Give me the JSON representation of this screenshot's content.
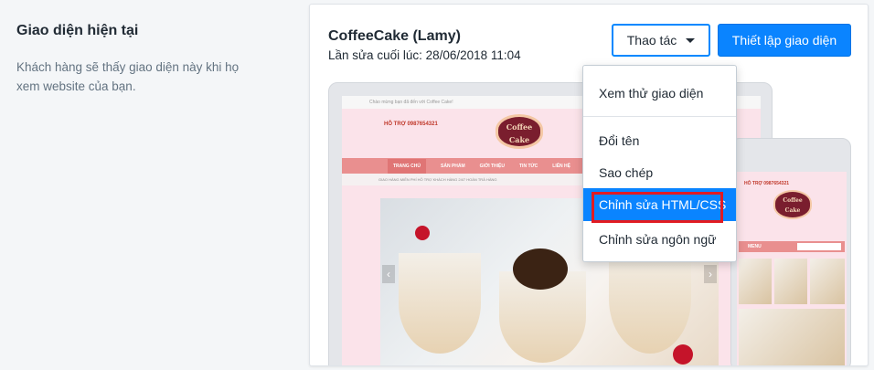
{
  "section": {
    "title": "Giao diện hiện tại",
    "description": "Khách hàng sẽ thấy giao diện này khi họ xem website của bạn."
  },
  "theme": {
    "name": "CoffeeCake (Lamy)",
    "last_edited": "Lần sửa cuối lúc: 28/06/2018 11:04"
  },
  "buttons": {
    "actions_label": "Thao tác",
    "customize_label": "Thiết lập giao diện"
  },
  "dropdown": {
    "items": [
      {
        "label": "Xem thử giao diện"
      },
      {
        "label": "Đổi tên"
      },
      {
        "label": "Sao chép"
      },
      {
        "label": "Chỉnh sửa HTML/CSS",
        "active": true,
        "highlighted": true
      },
      {
        "label": "Chỉnh sửa ngôn ngữ"
      }
    ]
  },
  "preview": {
    "topbar_text": "Chào mừng bạn đã đến với Coffee Cake!",
    "hotline": "HỖ TRỢ 0987654321",
    "logo_line1": "Coffee",
    "logo_line2": "Cake",
    "nav": [
      "TRANG CHỦ",
      "SẢN PHẨM",
      "GIỚI THIỆU",
      "TIN TỨC",
      "LIÊN HỆ"
    ],
    "strip_text": "GIAO HÀNG MIỄN PHÍ   HỖ TRỢ KHÁCH HÀNG 24/7   HOÀN TRẢ HÀNG",
    "mobile_hotline": "HỖ TRỢ 0987654321",
    "mobile_menu": "MENU",
    "colors": {
      "accent": "#0a84ff",
      "highlight": "#e11b22",
      "pink": "#fbe3ea",
      "nav_pink": "#e98f8f"
    }
  }
}
